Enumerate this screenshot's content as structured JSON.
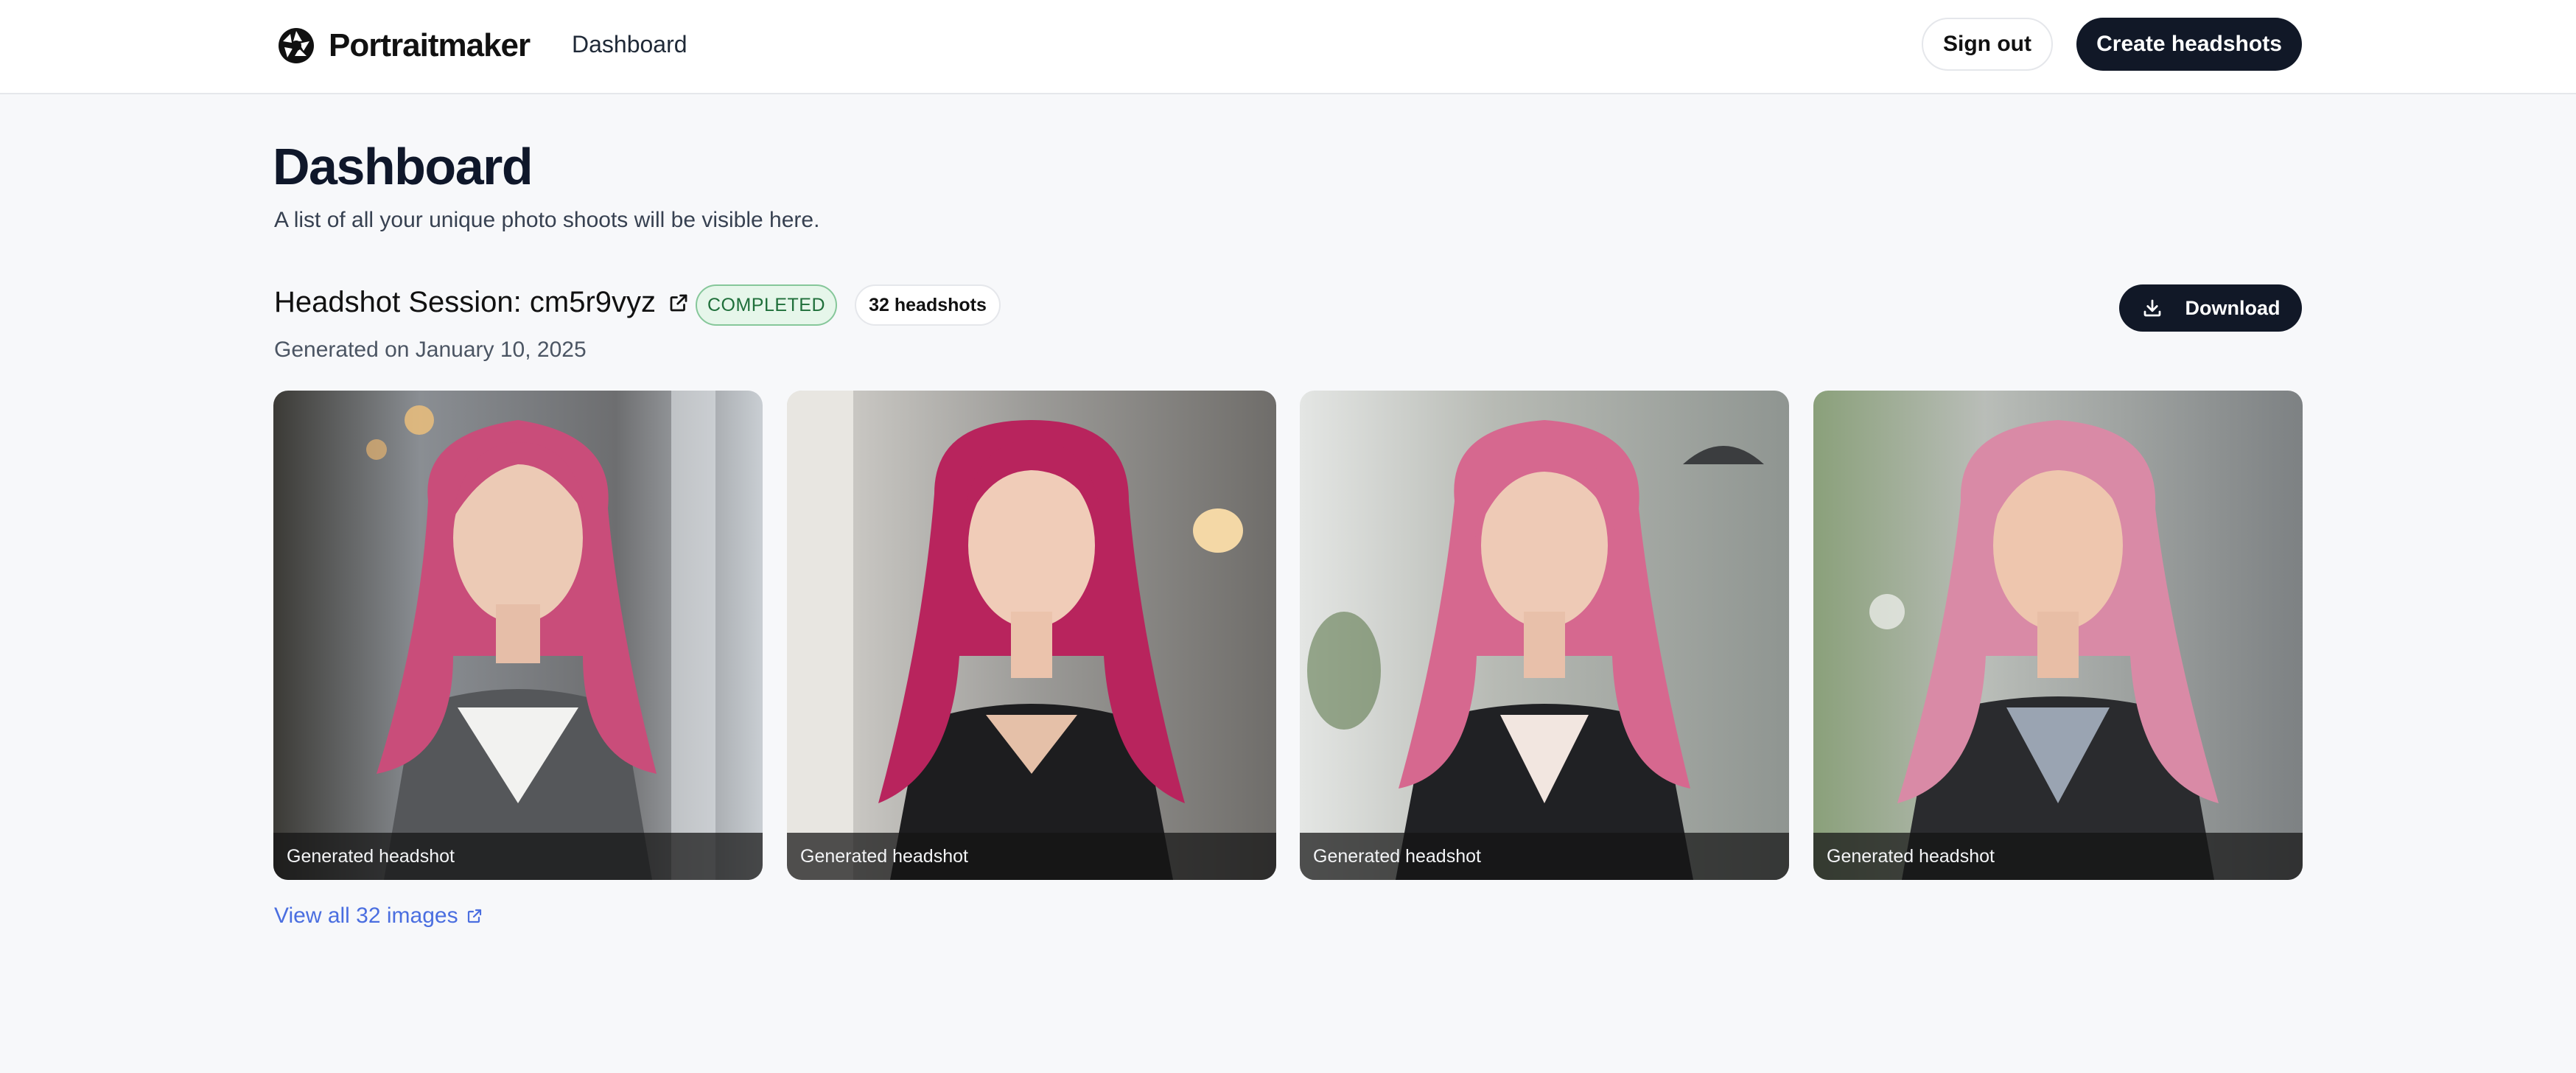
{
  "header": {
    "brand": "Portraitmaker",
    "nav_dashboard": "Dashboard",
    "sign_out": "Sign out",
    "create_headshots": "Create headshots"
  },
  "page": {
    "title": "Dashboard",
    "subtitle": "A list of all your unique photo shoots will be visible here."
  },
  "session": {
    "title": "Headshot Session: cm5r9vyz",
    "status": "COMPLETED",
    "count_label": "32 headshots",
    "download_label": "Download",
    "generated_on": "Generated on January 10, 2025",
    "photos": [
      {
        "caption": "Generated headshot"
      },
      {
        "caption": "Generated headshot"
      },
      {
        "caption": "Generated headshot"
      },
      {
        "caption": "Generated headshot"
      }
    ],
    "view_all": "View all 32 images"
  },
  "colors": {
    "primary_dark": "#111827",
    "link_blue": "#4a6ee0",
    "status_green": "#1f6f3a",
    "hair_pink": "#d5507f"
  },
  "icons": {
    "logo": "camera-aperture-icon",
    "external": "external-link-icon",
    "download": "download-icon"
  }
}
